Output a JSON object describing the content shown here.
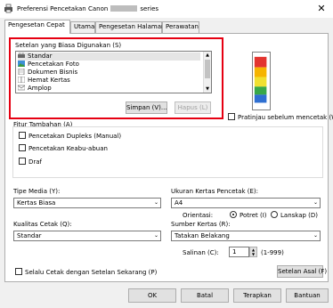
{
  "window": {
    "title_prefix": "Preferensi Pencetakan Canon",
    "title_suffix": "series",
    "close_glyph": "✕"
  },
  "tabs": [
    {
      "label": "Pengesetan Cepat"
    },
    {
      "label": "Utama"
    },
    {
      "label": "Pengesetan Halaman"
    },
    {
      "label": "Perawatan"
    }
  ],
  "settings_list": {
    "label": "Setelan yang Biasa Digunakan (S)",
    "items": [
      {
        "label": "Standar",
        "icon": "printer-icon"
      },
      {
        "label": "Pencetakan Foto",
        "icon": "photo-icon"
      },
      {
        "label": "Dokumen Bisnis",
        "icon": "document-icon"
      },
      {
        "label": "Hemat Kertas",
        "icon": "paper-saving-icon"
      },
      {
        "label": "Amplop",
        "icon": "envelope-icon"
      }
    ],
    "save_button": "Simpan (V)...",
    "delete_button": "Hapus (L)"
  },
  "preview_checkbox": "Pratinjau sebelum mencetak (W)",
  "additional_features": {
    "label": "Fitur Tambahan (A)",
    "options": [
      {
        "label": "Pencetakan Dupleks (Manual)",
        "checked": false
      },
      {
        "label": "Pencetakan Keabu-abuan",
        "checked": false
      },
      {
        "label": "Draf",
        "checked": false
      }
    ]
  },
  "media_type": {
    "label": "Tipe Media (Y):",
    "value": "Kertas Biasa"
  },
  "paper_size": {
    "label": "Ukuran Kertas Pencetak (E):",
    "value": "A4"
  },
  "orientation": {
    "label": "Orientasi:",
    "portrait": "Potret (I)",
    "landscape": "Lanskap (D)",
    "selected": "portrait"
  },
  "print_quality": {
    "label": "Kualitas Cetak (Q):",
    "value": "Standar"
  },
  "paper_source": {
    "label": "Sumber Kertas (R):",
    "value": "Tatakan Belakang"
  },
  "copies": {
    "label": "Salinan (C):",
    "value": "1",
    "range": "(1-999)"
  },
  "always_print_checkbox": "Selalu Cetak dengan Setelan Sekarang (P)",
  "defaults_button": "Setelan Asal (F)",
  "dialog_buttons": {
    "ok": "OK",
    "cancel": "Batal",
    "apply": "Terapkan",
    "help": "Bantuan"
  }
}
